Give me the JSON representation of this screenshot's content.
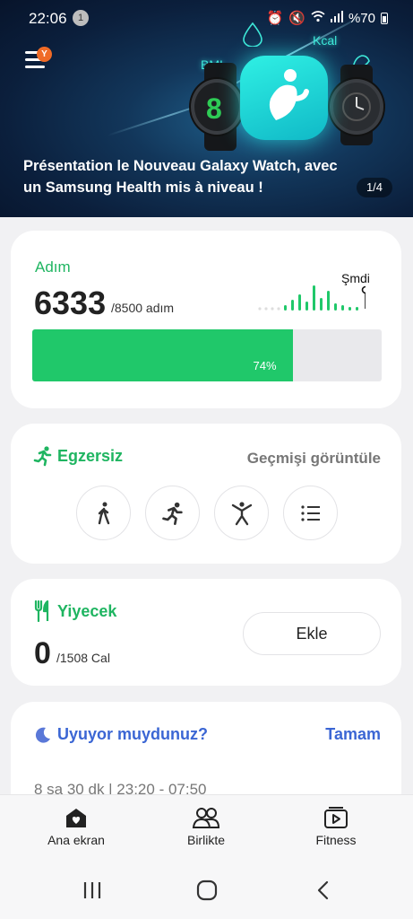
{
  "status_bar": {
    "time": "22:06",
    "notification_count": "1",
    "battery_text": "%70"
  },
  "banner": {
    "menu_badge": "Y",
    "glow_labels": [
      "BMI",
      "Kcal"
    ],
    "title": "Présentation le Nouveau Galaxy Watch, avec un Samsung Health mis à niveau !",
    "pager": "1/4"
  },
  "steps": {
    "title": "Adım",
    "count": "6333",
    "goal": "/8500 adım",
    "now_label": "Şmdi",
    "progress_fraction": 0.745,
    "progress_text": "74%"
  },
  "exercise": {
    "title": "Egzersiz",
    "history_link": "Geçmişi görüntüle",
    "buttons": [
      {
        "icon": "walking-icon"
      },
      {
        "icon": "running-icon"
      },
      {
        "icon": "stretching-icon"
      },
      {
        "icon": "list-icon"
      }
    ]
  },
  "food": {
    "title": "Yiyecek",
    "count": "0",
    "goal": "/1508 Cal",
    "add_label": "Ekle"
  },
  "sleep": {
    "title": "Uyuyor muydunuz?",
    "ok_label": "Tamam",
    "info": "8 sa 30 dk  |  23:20 - 07:50"
  },
  "bottom_nav": [
    {
      "label": "Ana ekran",
      "icon": "home-heart-icon"
    },
    {
      "label": "Birlikte",
      "icon": "people-icon"
    },
    {
      "label": "Fitness",
      "icon": "video-play-icon"
    }
  ],
  "colors": {
    "accent_green": "#20c86a",
    "title_green": "#1fb561",
    "sleep_blue": "#3b66d4",
    "banner_dark": "#0b1f3c"
  }
}
